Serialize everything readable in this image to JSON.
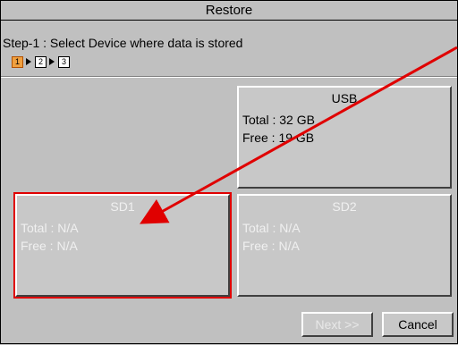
{
  "window": {
    "title": "Restore"
  },
  "step_instruction": "Step-1 : Select Device where data is stored",
  "steps": [
    {
      "number": "1",
      "state": "active"
    },
    {
      "number": "2",
      "state": "inactive"
    },
    {
      "number": "3",
      "state": "inactive"
    }
  ],
  "devices": {
    "usb": {
      "name": "USB",
      "total": "Total : 32 GB",
      "free": "Free : 19 GB",
      "enabled": true
    },
    "sd1": {
      "name": "SD1",
      "total": "Total : N/A",
      "free": "Free : N/A",
      "enabled": false,
      "highlighted": true
    },
    "sd2": {
      "name": "SD2",
      "total": "Total : N/A",
      "free": "Free : N/A",
      "enabled": false
    }
  },
  "buttons": {
    "next_label": "Next >>",
    "cancel_label": "Cancel"
  },
  "colors": {
    "annotation_arrow": "#e00000",
    "active_step": "#f0a040",
    "panel_bg": "#c0c0c0"
  }
}
